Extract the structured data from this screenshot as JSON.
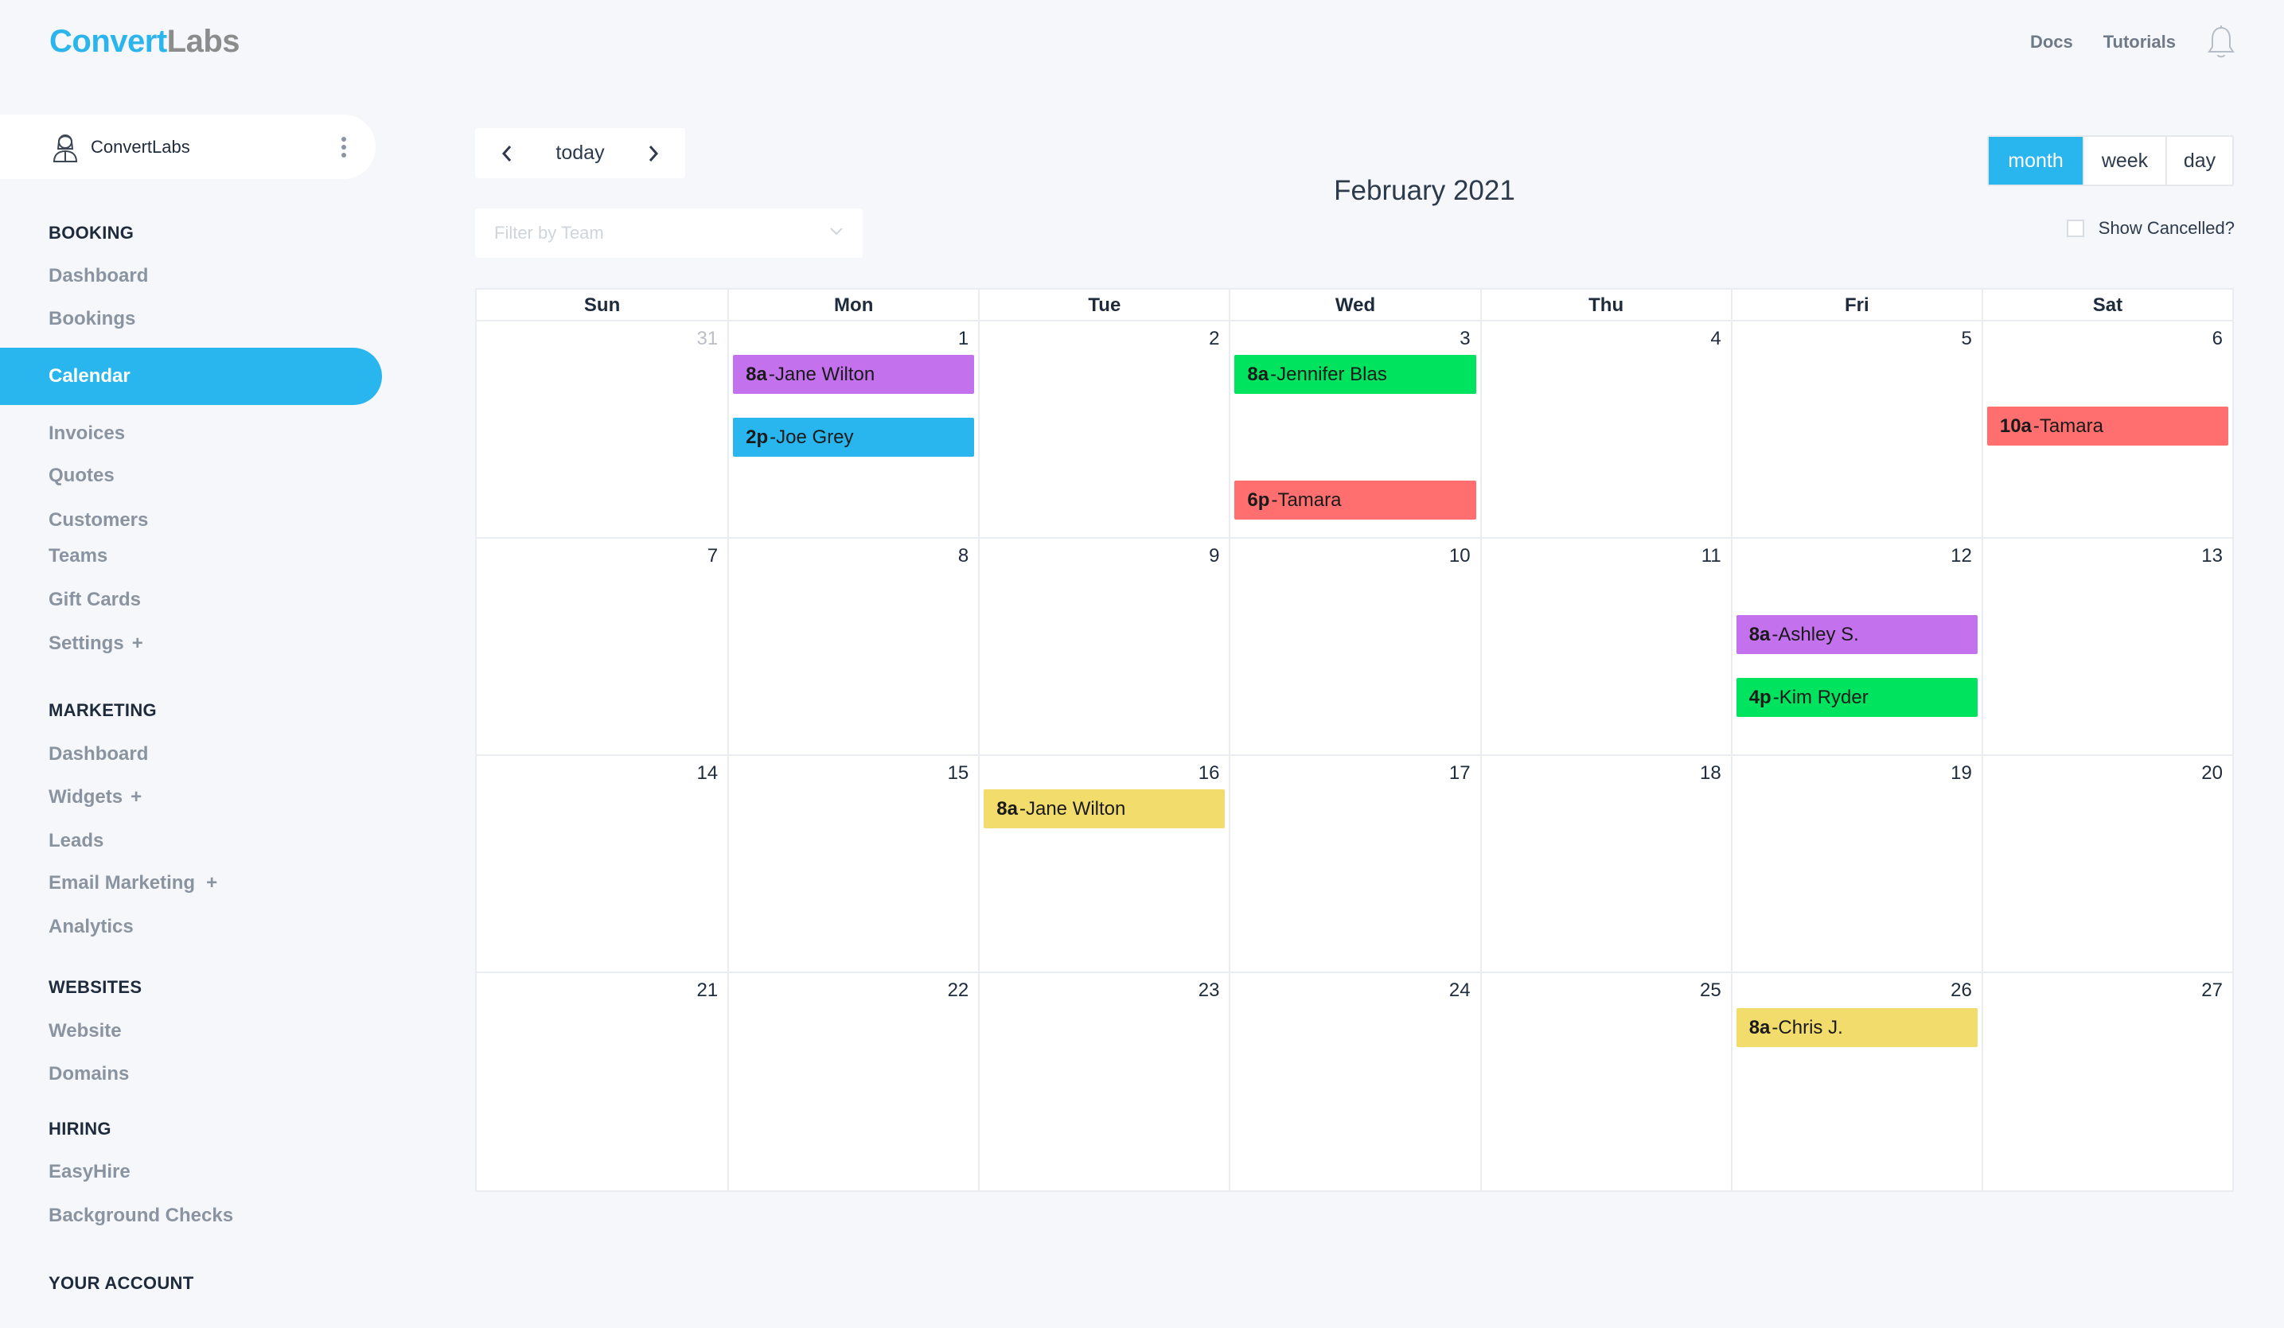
{
  "brand": {
    "part1": "Convert",
    "part2": "Labs"
  },
  "topnav": {
    "docs": "Docs",
    "tutorials": "Tutorials",
    "bell_icon": "bell-icon"
  },
  "account": {
    "name": "ConvertLabs",
    "avatar_icon": "user-avatar-icon",
    "menu_icon": "kebab-menu-icon"
  },
  "sidebar": {
    "booking": {
      "title": "BOOKING",
      "items": [
        "Dashboard",
        "Bookings",
        "Calendar",
        "Invoices",
        "Quotes",
        "Customers",
        "Teams",
        "Gift Cards",
        "Settings"
      ],
      "active": "Calendar"
    },
    "marketing": {
      "title": "MARKETING",
      "items": [
        "Dashboard",
        "Widgets",
        "Leads",
        "Email Marketing",
        "Analytics"
      ]
    },
    "websites": {
      "title": "WEBSITES",
      "items": [
        "Website",
        "Domains"
      ]
    },
    "hiring": {
      "title": "HIRING",
      "items": [
        "EasyHire",
        "Background Checks"
      ]
    },
    "account_title": "YOUR ACCOUNT",
    "plus": "+"
  },
  "toolbar": {
    "today": "today",
    "prev_icon": "chevron-left-icon",
    "next_icon": "chevron-right-icon",
    "filter_placeholder": "Filter by Team",
    "title": "February 2021",
    "views": [
      "month",
      "week",
      "day"
    ],
    "active_view": "month",
    "show_cancelled": "Show Cancelled?"
  },
  "calendar": {
    "weekdays": [
      "Sun",
      "Mon",
      "Tue",
      "Wed",
      "Thu",
      "Fri",
      "Sat"
    ],
    "weeks": [
      [
        "31",
        "1",
        "2",
        "3",
        "4",
        "5",
        "6"
      ],
      [
        "7",
        "8",
        "9",
        "10",
        "11",
        "12",
        "13"
      ],
      [
        "14",
        "15",
        "16",
        "17",
        "18",
        "19",
        "20"
      ],
      [
        "21",
        "22",
        "23",
        "24",
        "25",
        "26",
        "27"
      ]
    ],
    "events": [
      {
        "time": "8a",
        "name": "Jane Wilton",
        "color": "#c471ed"
      },
      {
        "time": "2p",
        "name": "Joe Grey",
        "color": "#29b6ef"
      },
      {
        "time": "8a",
        "name": "Jennifer Blas",
        "color": "#00e35f"
      },
      {
        "time": "6p",
        "name": "Tamara",
        "color": "#ff6f6f"
      },
      {
        "time": "10a",
        "name": "Tamara",
        "color": "#ff6f6f"
      },
      {
        "time": "8a",
        "name": "Ashley S.",
        "color": "#c471ed"
      },
      {
        "time": "4p",
        "name": "Kim Ryder",
        "color": "#00e35f"
      },
      {
        "time": "8a",
        "name": "Jane Wilton",
        "color": "#f2dc6b"
      },
      {
        "time": "8a",
        "name": "Chris J.",
        "color": "#f2dc6b"
      }
    ],
    "separator": " - "
  }
}
